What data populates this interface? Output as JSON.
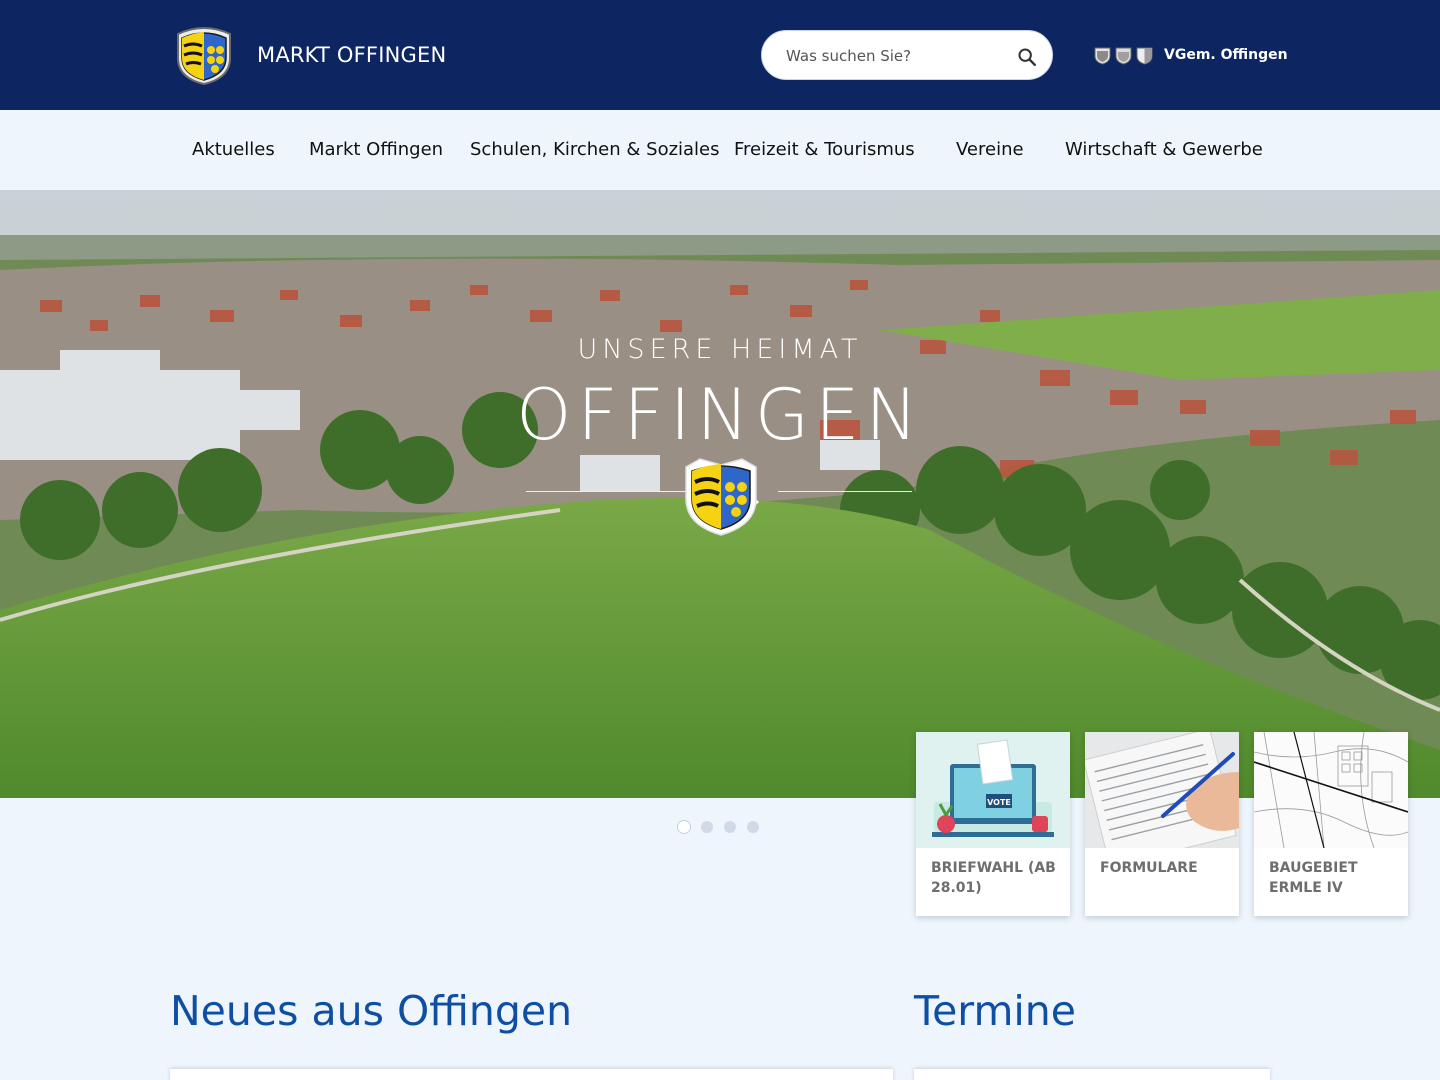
{
  "header": {
    "site_title": "MARKT OFFINGEN",
    "search_placeholder": "Was suchen Sie?",
    "vgem_label": "VGem. Offingen"
  },
  "nav": {
    "items": [
      {
        "label": "Aktuelles"
      },
      {
        "label": "Markt Offingen"
      },
      {
        "label": "Schulen, Kirchen & Soziales"
      },
      {
        "label": "Freizeit & Tourismus"
      },
      {
        "label": "Vereine"
      },
      {
        "label": "Wirtschaft & Gewerbe"
      }
    ]
  },
  "hero": {
    "kicker": "UNSERE HEIMAT",
    "title": "OFFINGEN",
    "slide_count": 4,
    "active_slide": 1
  },
  "quick_links": [
    {
      "label": "Briefwahl (ab 28.01)",
      "image": "vote-illustration",
      "image_text": "VOTE"
    },
    {
      "label": "Formulare",
      "image": "form-writing-photo"
    },
    {
      "label": "Baugebiet Ermle IV",
      "image": "site-plan-map"
    }
  ],
  "sections": {
    "news_title": "Neues aus Offingen",
    "events_title": "Termine"
  },
  "colors": {
    "header_bg": "#0d2561",
    "nav_bg": "#eef5fd",
    "heading_blue": "#0e4fa3",
    "crest_yellow": "#f5d312",
    "crest_blue": "#2f66c9"
  },
  "icons": {
    "search": "search-icon",
    "logo": "coat-of-arms-icon"
  }
}
